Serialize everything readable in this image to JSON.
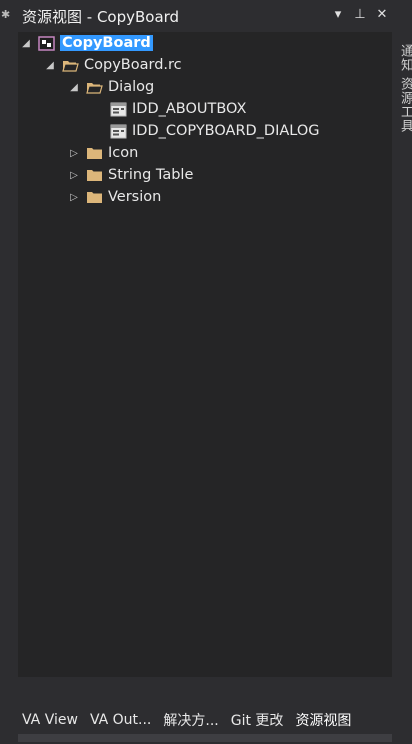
{
  "window": {
    "title": "资源视图 - CopyBoard"
  },
  "title_tools": [
    {
      "name": "dropdown-icon",
      "glyph": "▾"
    },
    {
      "name": "pin-icon",
      "glyph": "⊥"
    },
    {
      "name": "close-icon",
      "glyph": "✕"
    }
  ],
  "tree": {
    "project": {
      "label": "CopyBoard",
      "expanded": true
    },
    "rc_file": {
      "label": "CopyBoard.rc",
      "expanded": true
    },
    "dialog_folder": {
      "label": "Dialog",
      "expanded": true
    },
    "dialogs": [
      "IDD_ABOUTBOX",
      "IDD_COPYBOARD_DIALOG"
    ],
    "folders": [
      {
        "label": "Icon",
        "expanded": false
      },
      {
        "label": "String Table",
        "expanded": false
      },
      {
        "label": "Version",
        "expanded": false
      }
    ]
  },
  "bottom_tabs": [
    "VA View",
    "VA Out...",
    "解决方...",
    "Git 更改",
    "资源视图"
  ],
  "active_tab": "资源视图",
  "side_tab": "通知  资源工具",
  "colors": {
    "selection": "#3399ff",
    "folder": "#dcb67a",
    "background": "#252526",
    "chrome": "#2d2d30"
  }
}
